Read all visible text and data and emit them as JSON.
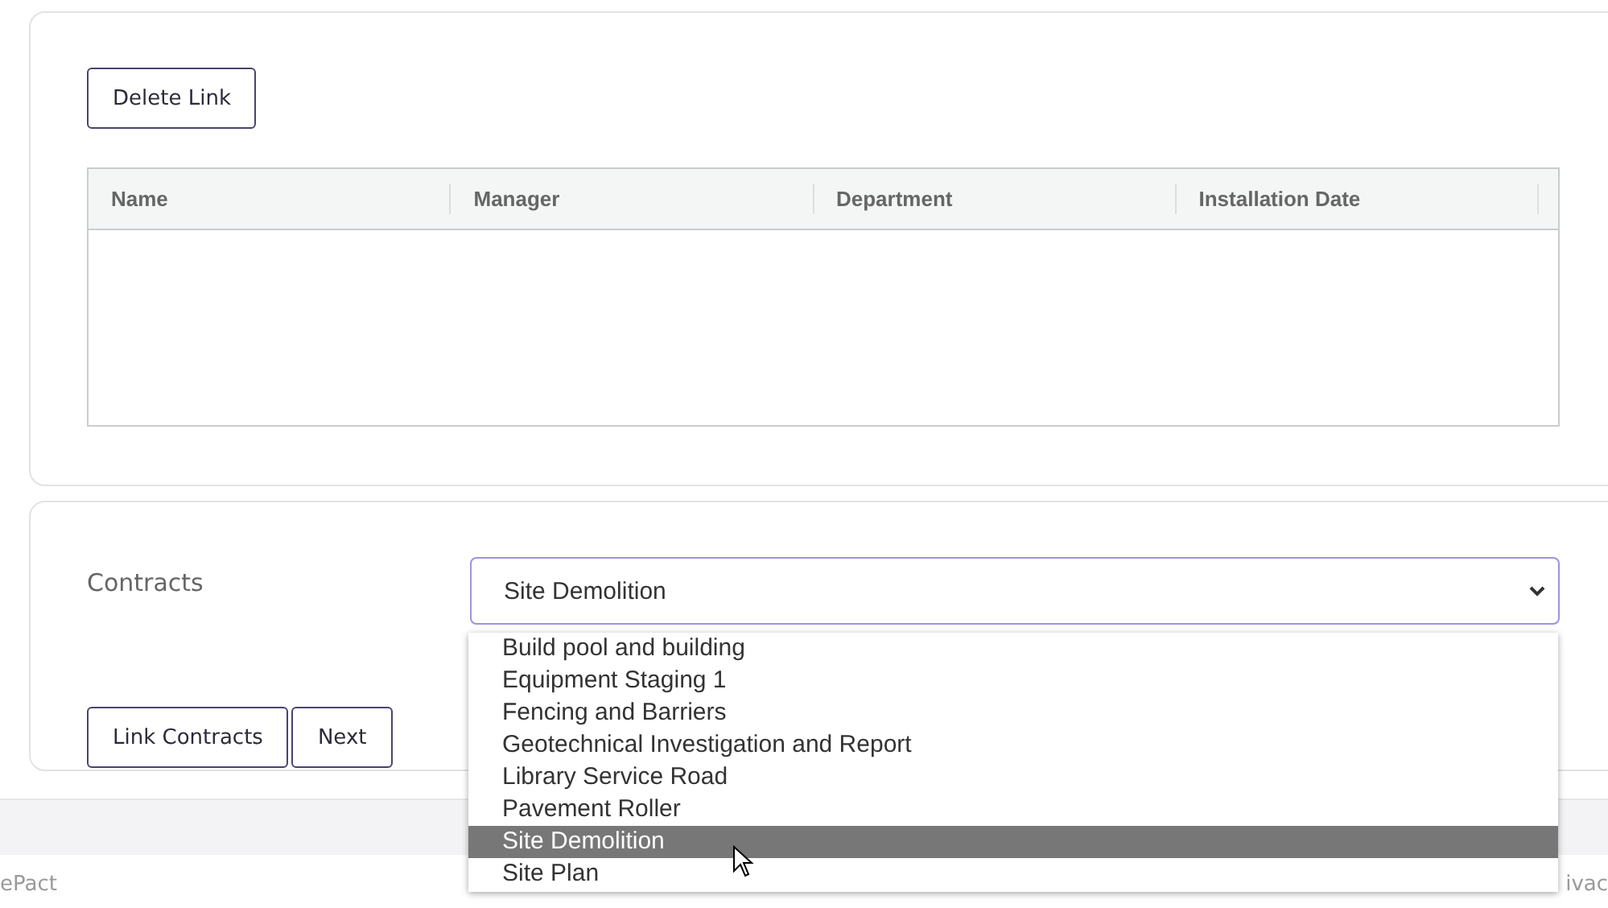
{
  "links_card": {
    "delete_button": "Delete Link",
    "table": {
      "columns": [
        "Name",
        "Manager",
        "Department",
        "Installation Date"
      ]
    }
  },
  "contracts_card": {
    "label": "Contracts",
    "select": {
      "value": "Site Demolition",
      "expanded": true,
      "options": [
        {
          "label": "Build pool and building",
          "selected": false
        },
        {
          "label": "Equipment Staging 1",
          "selected": false
        },
        {
          "label": "Fencing and Barriers",
          "selected": false
        },
        {
          "label": "Geotechnical Investigation and Report",
          "selected": false
        },
        {
          "label": "Library Service Road",
          "selected": false
        },
        {
          "label": "Pavement Roller",
          "selected": false
        },
        {
          "label": "Site Demolition",
          "selected": true
        },
        {
          "label": "Site Plan",
          "selected": false
        }
      ]
    },
    "buttons": [
      "Link Contracts",
      "Next"
    ]
  },
  "footer": {
    "left_text": "ePact",
    "right_text": "ivac"
  }
}
